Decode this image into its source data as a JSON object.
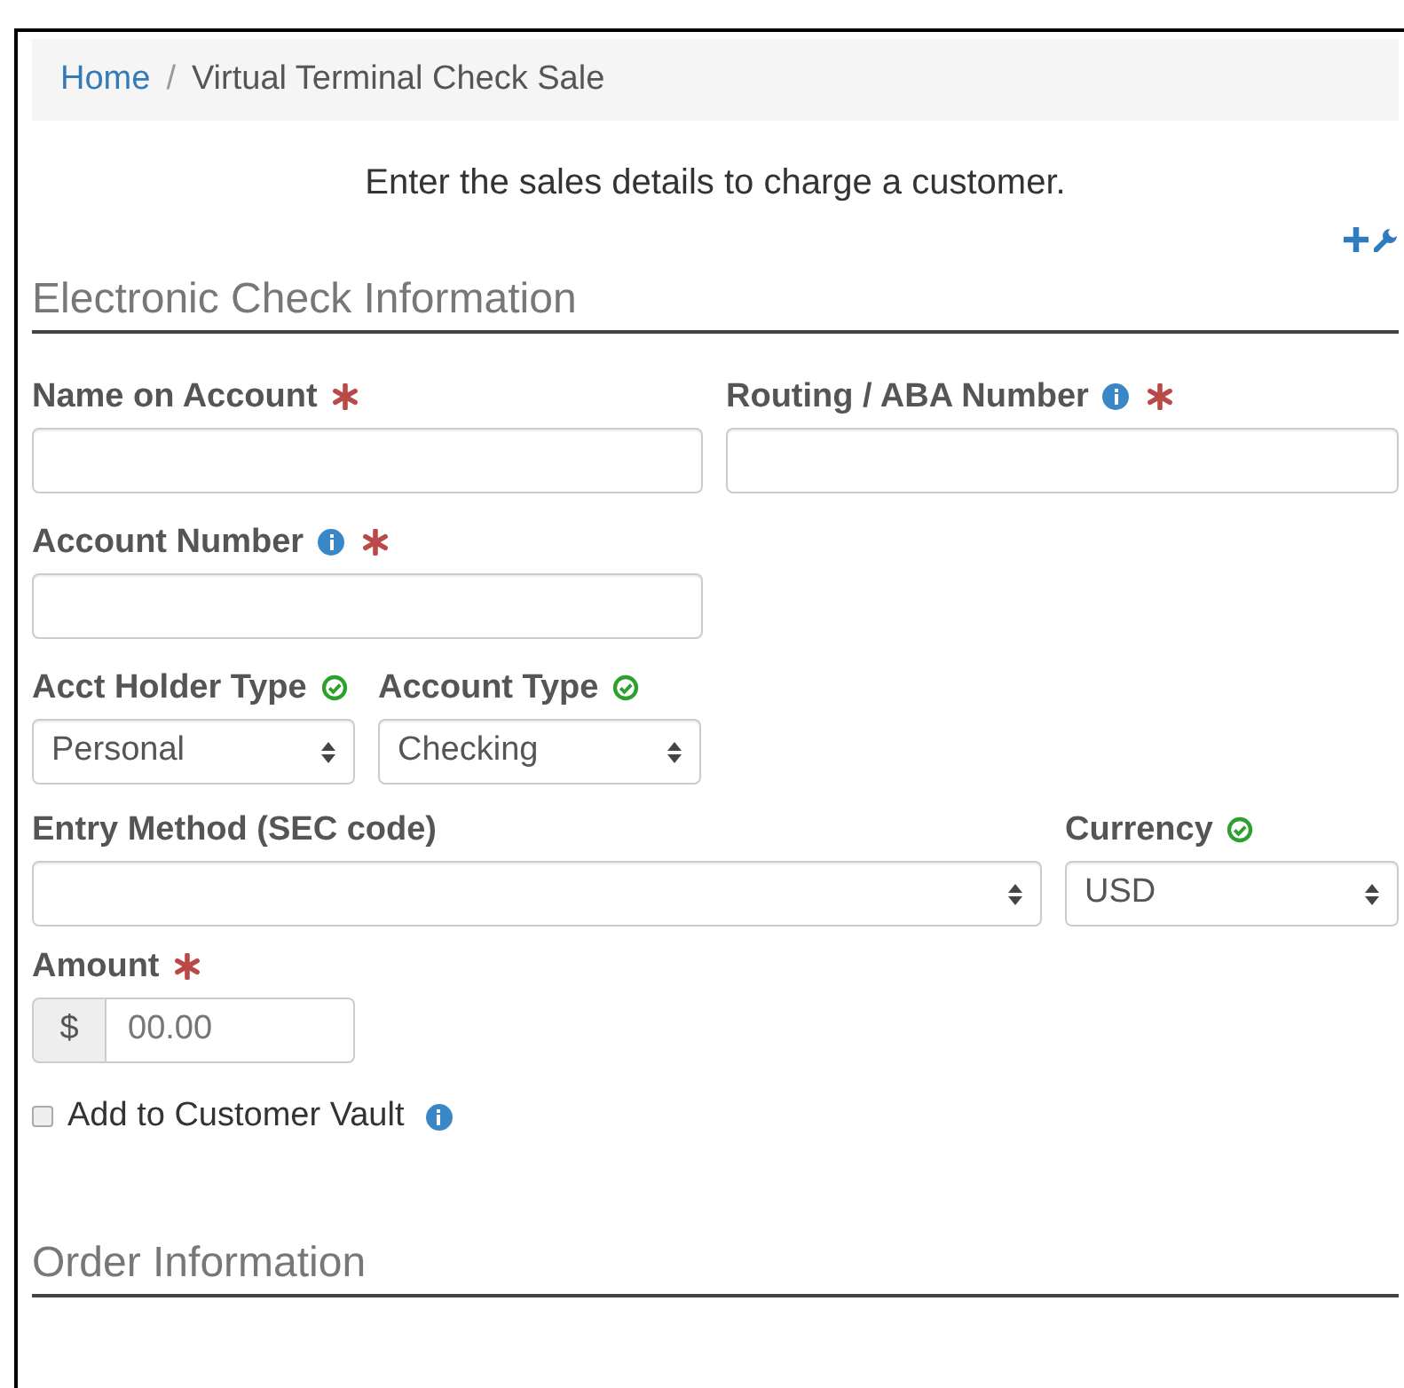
{
  "breadcrumb": [
    {
      "label": "Home",
      "kind": "link"
    },
    {
      "label": "/",
      "kind": "separator"
    },
    {
      "label": "Virtual Terminal Check Sale",
      "kind": "current"
    }
  ],
  "subtitle": "Enter the sales details to charge a customer.",
  "sections": [
    {
      "title": "Electronic Check Information",
      "rows": [
        [
          {
            "label": "Name on Account",
            "kind": "text",
            "required": true,
            "info": false,
            "validated": false
          },
          {
            "label": "Routing / ABA Number",
            "kind": "text",
            "required": true,
            "info": true,
            "validated": false
          }
        ],
        [
          {
            "label": "Account Number",
            "kind": "text",
            "required": true,
            "info": true,
            "validated": false
          }
        ],
        [
          {
            "label": "Acct Holder Type",
            "kind": "select",
            "value": "Personal",
            "required": false,
            "info": false,
            "validated": true
          },
          {
            "label": "Account Type",
            "kind": "select",
            "value": "Checking",
            "required": false,
            "info": false,
            "validated": true
          }
        ],
        [
          {
            "label": "Entry Method (SEC code)",
            "kind": "select",
            "required": false,
            "info": false,
            "validated": false
          },
          {
            "label": "Currency",
            "kind": "select",
            "value": "USD",
            "required": false,
            "info": false,
            "validated": true
          }
        ],
        [
          {
            "label": "Amount",
            "kind": "amount",
            "prefix": "$",
            "placeholder": "00.00",
            "required": true,
            "info": false,
            "validated": false
          }
        ]
      ],
      "checkbox": {
        "label": "Add to Customer Vault",
        "checked": false,
        "info": true
      }
    },
    {
      "title": "Order Information"
    }
  ]
}
